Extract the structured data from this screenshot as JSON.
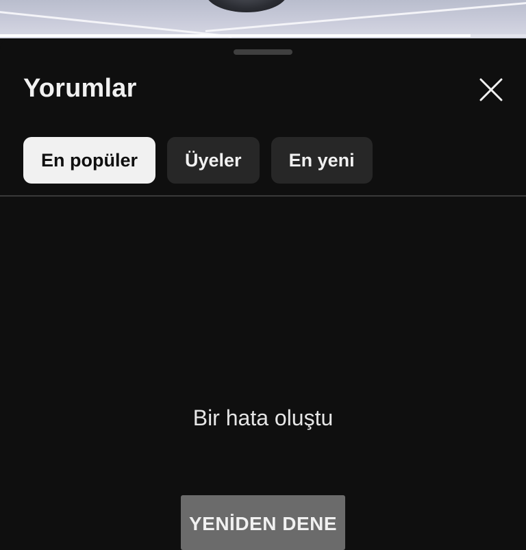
{
  "video": {
    "progress_fraction": 0.895
  },
  "comments_sheet": {
    "title": "Yorumlar",
    "close_icon": "close-icon",
    "chips": [
      {
        "label": "En popüler",
        "active": true
      },
      {
        "label": "Üyeler",
        "active": false
      },
      {
        "label": "En yeni",
        "active": false
      }
    ],
    "error_message": "Bir hata oluştu",
    "retry_label": "YENİDEN DENE"
  },
  "colors": {
    "background": "#0f0f0f",
    "chip_active_bg": "#f1f1f1",
    "chip_bg": "#272727",
    "retry_bg": "#6b6b6b"
  }
}
